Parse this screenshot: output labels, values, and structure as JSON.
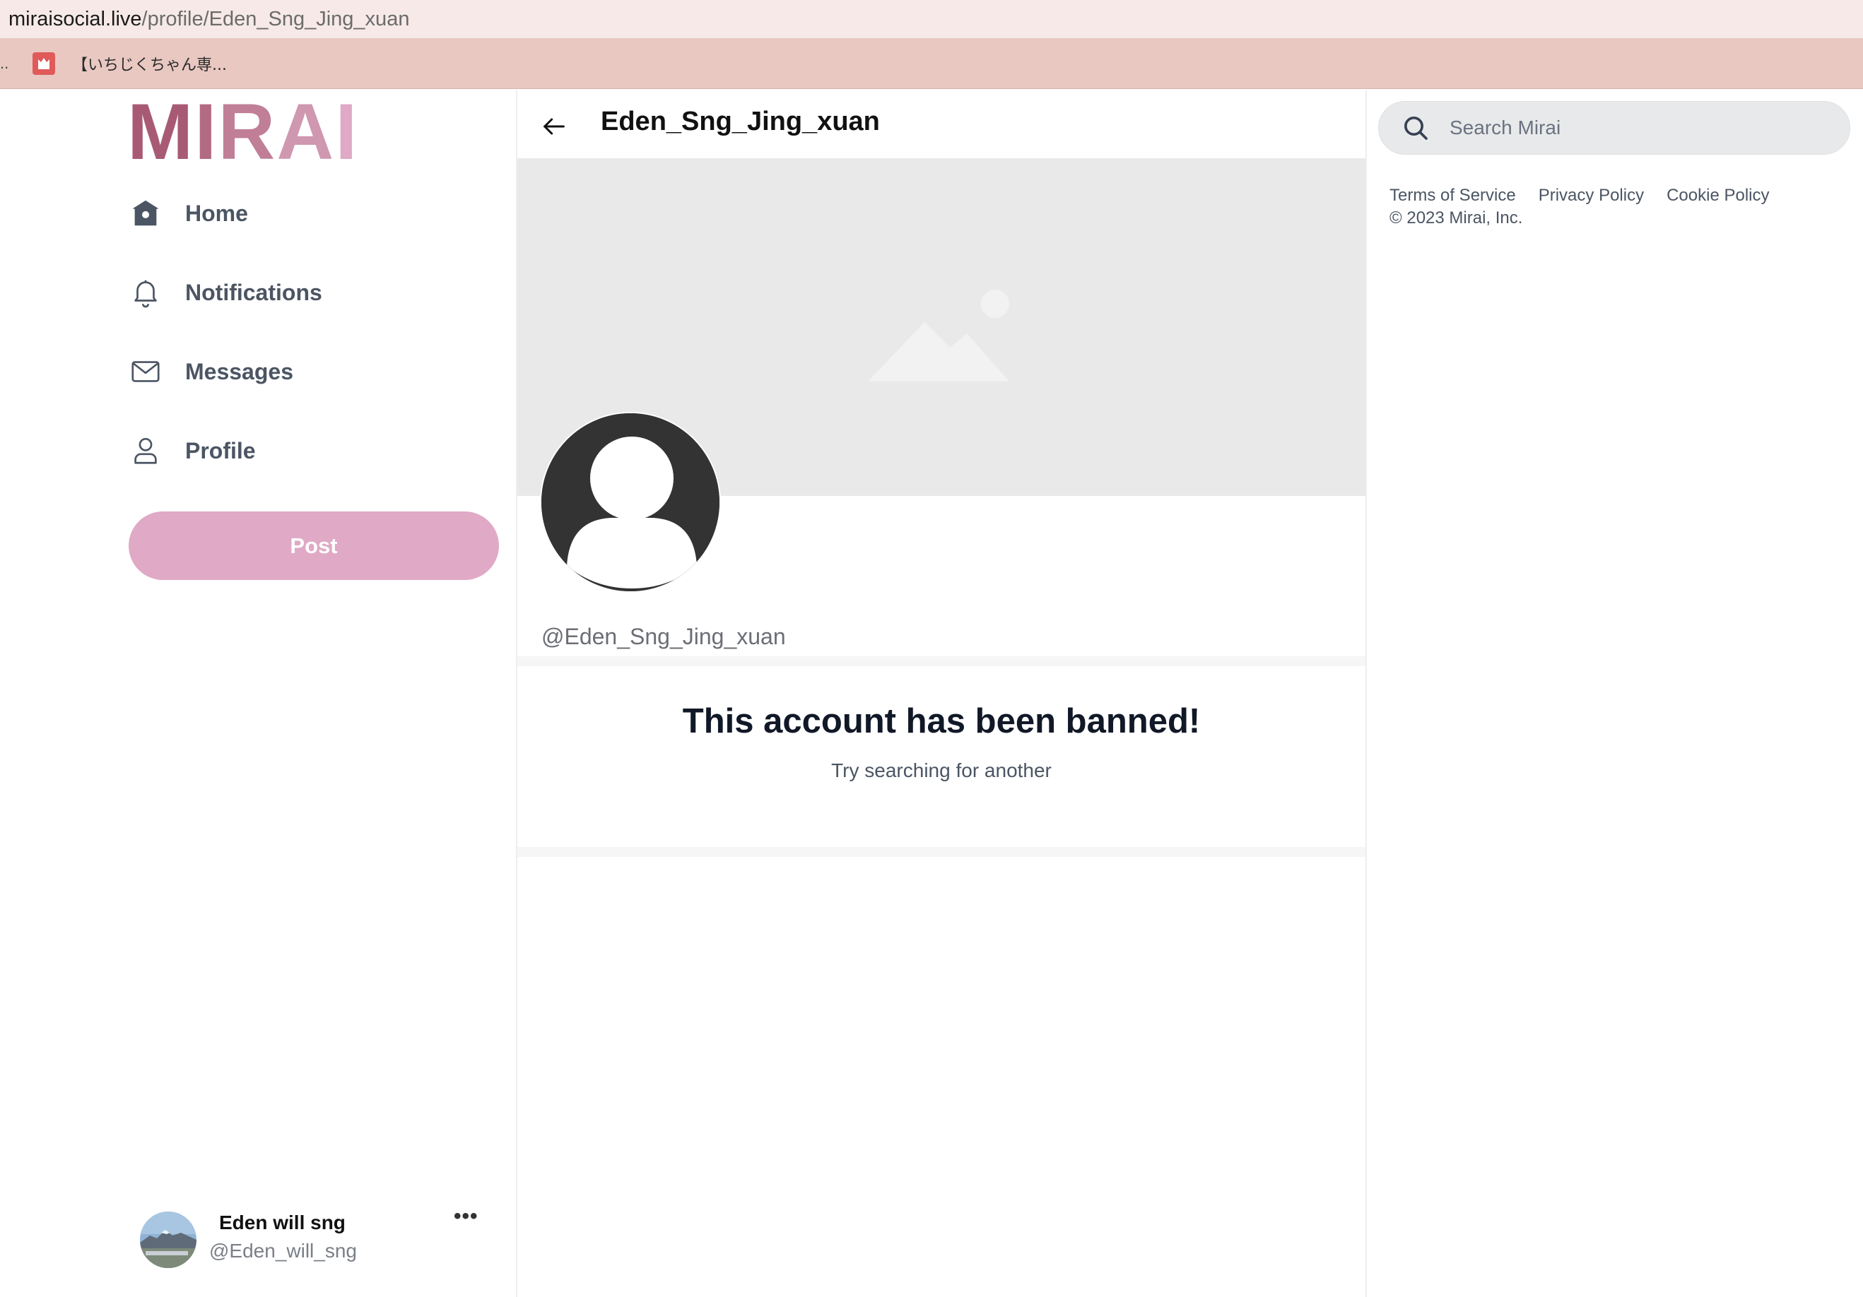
{
  "browser": {
    "url_domain": "miraisocial.live",
    "url_path": "/profile/Eden_Sng_Jing_xuan",
    "bookmark_overflow": "..",
    "bookmark_label": "【いちじくちゃん専..."
  },
  "logo": {
    "letters": [
      "M",
      "I",
      "R",
      "A",
      "I"
    ]
  },
  "nav": {
    "home": "Home",
    "notifications": "Notifications",
    "messages": "Messages",
    "profile": "Profile"
  },
  "post_button": "Post",
  "account": {
    "name": "Eden will sng",
    "handle": "@Eden_will_sng",
    "more": "•••"
  },
  "profile": {
    "header_title": "Eden_Sng_Jing_xuan",
    "handle": "@Eden_Sng_Jing_xuan",
    "banned_title": "This account has been banned!",
    "banned_subtitle": "Try searching for another"
  },
  "search": {
    "placeholder": "Search Mirai"
  },
  "footer": {
    "terms": "Terms of Service",
    "privacy": "Privacy Policy",
    "cookie": "Cookie Policy",
    "copyright": "© 2023 Mirai, Inc."
  },
  "colors": {
    "brand_dark": "#a85a74",
    "brand_mid": "#c98aa5",
    "brand_light": "#e0a9c6",
    "urlbar_bg": "#f6e9e7",
    "bookmarks_bg": "#e9c8c2"
  },
  "icons": [
    "home-icon",
    "bell-icon",
    "envelope-icon",
    "person-icon",
    "arrow-left-icon",
    "search-icon",
    "image-placeholder-icon",
    "avatar-placeholder-icon"
  ]
}
